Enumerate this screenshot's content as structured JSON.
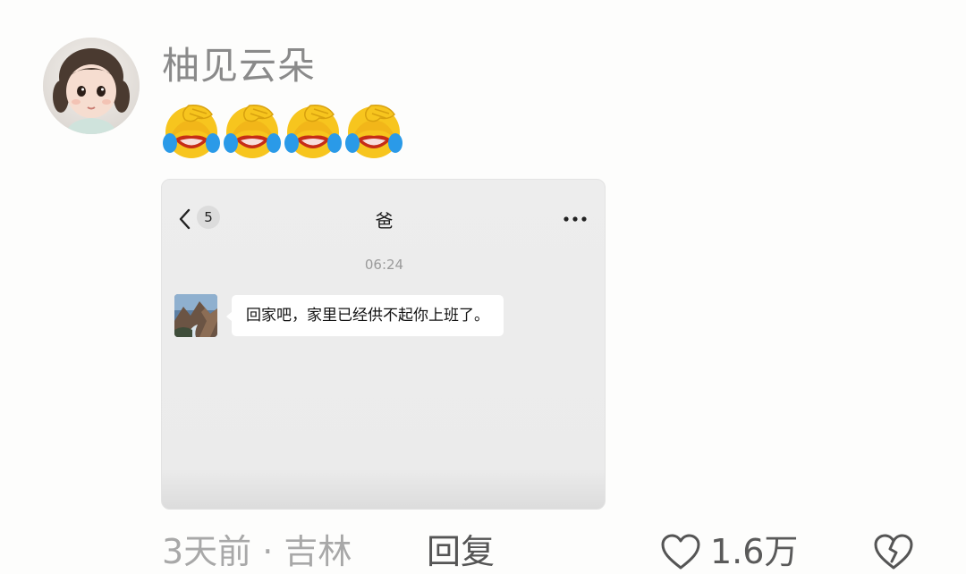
{
  "comment": {
    "username": "柚见云朵",
    "reaction_emojis": [
      "facepalm-laugh-cry-emoji",
      "facepalm-laugh-cry-emoji",
      "facepalm-laugh-cry-emoji",
      "facepalm-laugh-cry-emoji"
    ],
    "meta": "3天前 · 吉林",
    "reply_label": "回复",
    "like_count": "1.6万",
    "icons": {
      "avatar": "child-avatar",
      "like": "heart-outline-icon",
      "dislike": "broken-heart-icon"
    }
  },
  "screenshot": {
    "unread_badge": "5",
    "chat_title": "爸",
    "time": "06:24",
    "message": "回家吧，家里已经供不起你上班了。",
    "icons": {
      "back": "chevron-left-icon",
      "more": "more-dots-icon",
      "sender_avatar": "landscape-avatar"
    }
  },
  "colors": {
    "username": "#8a8a8a",
    "meta": "#a8a8a8",
    "chat_bg": "#ededed"
  }
}
